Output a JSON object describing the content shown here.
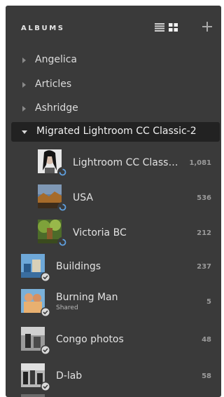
{
  "header": {
    "title": "ALBUMS"
  },
  "icons": {
    "list_view": "list-view-icon",
    "grid_view": "grid-view-icon",
    "add": "add-icon"
  },
  "folders": [
    {
      "label": "Angelica"
    },
    {
      "label": "Articles"
    },
    {
      "label": "Ashridge"
    }
  ],
  "selected_folder": {
    "label": "Migrated Lightroom CC Classic-2"
  },
  "nested_albums": [
    {
      "label": "Lightroom CC Class…",
      "count": "1,081",
      "badge": "sync"
    },
    {
      "label": "USA",
      "count": "536",
      "badge": "sync"
    },
    {
      "label": "Victoria BC",
      "count": "212",
      "badge": "sync"
    }
  ],
  "albums": [
    {
      "label": "Buildings",
      "count": "237",
      "badge": "check"
    },
    {
      "label": "Burning Man",
      "sublabel": "Shared",
      "count": "5",
      "badge": "check"
    },
    {
      "label": "Congo photos",
      "count": "48",
      "badge": "check"
    },
    {
      "label": "D-lab",
      "count": "58",
      "badge": "check"
    }
  ],
  "colors": {
    "panel_bg": "#3a3a3a",
    "selected_bg": "#222222",
    "sync_badge": "#5fa0e0"
  }
}
